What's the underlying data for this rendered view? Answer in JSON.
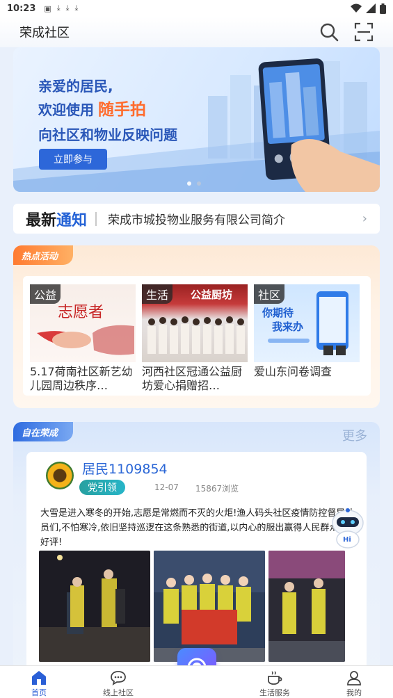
{
  "status_bar": {
    "time": "10:23",
    "notification_icons": [
      "image-icon",
      "download-icon",
      "download-icon",
      "download-icon"
    ]
  },
  "header": {
    "title": "荣成社区"
  },
  "banner": {
    "line1": "亲爱的居民,",
    "line2_prefix": "欢迎使用",
    "line2_highlight": "随手拍",
    "line3": "向社区和物业反映问题",
    "button": "立即参与",
    "colors": {
      "headline": "#2a57b8",
      "highlight": "#ff6b2c",
      "button": "#2d67d9"
    }
  },
  "notice": {
    "tag_black": "最新",
    "tag_blue": "通知",
    "text": "荣成市城投物业服务有限公司简介"
  },
  "hot": {
    "label": "热点活动",
    "cards": [
      {
        "badge": "公益",
        "title": "5.17荷南社区新艺幼儿园周边秩序…",
        "img_text": "志愿者"
      },
      {
        "badge": "生活",
        "title": "河西社区冠通公益厨坊爱心捐赠招…",
        "img_text": "公益厨坊"
      },
      {
        "badge": "社区",
        "title": "爱山东问卷调查",
        "img_text_1": "你期待",
        "img_text_2": "我来办"
      }
    ]
  },
  "zc": {
    "label": "自在荣成",
    "more": "更多",
    "post": {
      "user": "居民1109854",
      "tag": "党引领",
      "date": "12-07",
      "views": "15867浏览",
      "body": "大雪是进入寒冬的开始,志愿是常燃而不灭的火炬!渔人码头社区疫情防控督导队员们,不怕寒冷,依旧坚持巡逻在这条熟悉的街道,以内心的服出赢得人民群众的好评!"
    }
  },
  "robot": {
    "label": "Hi"
  },
  "tabbar": {
    "items": [
      {
        "label": "首页",
        "icon": "home-icon"
      },
      {
        "label": "线上社区",
        "icon": "chat-icon"
      },
      {
        "label": "生活服务",
        "icon": "coffee-icon"
      },
      {
        "label": "我的",
        "icon": "person-icon"
      }
    ],
    "active_index": 0,
    "accent": "#2a5fd6"
  }
}
